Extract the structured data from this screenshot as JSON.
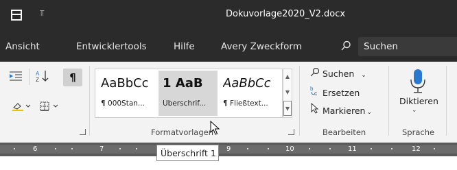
{
  "titlebar": {
    "qat_glyph": "⫪",
    "document_title": "Dokuvorlage2020_V2.docx"
  },
  "tabs": [
    {
      "label": "Ansicht"
    },
    {
      "label": "Entwicklertools"
    },
    {
      "label": "Hilfe"
    },
    {
      "label": "Avery Zweckform"
    }
  ],
  "search": {
    "label": "Suchen",
    "icon": "search-icon"
  },
  "paragraph": {
    "pilcrow": "¶"
  },
  "styles": {
    "group_label": "Formatvorlagen",
    "items": [
      {
        "preview": "AaBbCc",
        "name": "¶ 000Stan..."
      },
      {
        "preview": "1  AaB",
        "name": "Überschrif..."
      },
      {
        "preview": "AaBbCc",
        "name": "¶ Fließtext..."
      }
    ]
  },
  "editing": {
    "group_label": "Bearbeiten",
    "find": "Suchen",
    "replace": "Ersetzen",
    "select": "Markieren"
  },
  "voice": {
    "group_label": "Sprache",
    "dictate": "Diktieren"
  },
  "ruler": {
    "numbers": [
      "6",
      "7",
      "8",
      "9",
      "10",
      "11",
      "12"
    ]
  },
  "tooltip": {
    "text": "Überschrift 1"
  },
  "colors": {
    "titlebar_bg": "#2b2b2b",
    "ribbon_bg": "#f3f3f3",
    "accent_blue": "#2b78d0"
  }
}
